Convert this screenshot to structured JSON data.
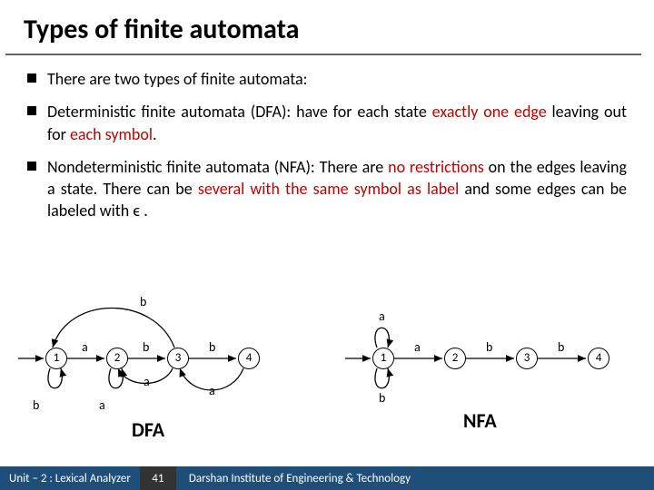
{
  "title": "Types of finite automata",
  "bullets": {
    "b1": "There are two types of finite automata:",
    "b2a": "Deterministic finite automata (DFA): ",
    "b2b": "have for each state ",
    "b2c": "exactly one edge",
    "b2d": " leaving out for ",
    "b2e": "each symbol",
    "b2f": ".",
    "b3a": "Nondeterministic finite automata (NFA): There are ",
    "b3b": "no restrictions",
    "b3c": " on the edges leaving a state. There can be ",
    "b3d": "several with the same symbol as label",
    "b3e": " and some edges can be labeled with ",
    "b3f": "ϵ",
    "b3g": " ."
  },
  "dfa": {
    "title": "DFA",
    "states": {
      "s1": "1",
      "s2": "2",
      "s3": "3",
      "s4": "4"
    },
    "labels": {
      "t12": "a",
      "t23": "b",
      "t34": "b",
      "loop1": "b",
      "loop2": "a",
      "t31top": "b",
      "t32bot": "a",
      "t43": "a"
    }
  },
  "nfa": {
    "title": "NFA",
    "states": {
      "s1": "1",
      "s2": "2",
      "s3": "3",
      "s4": "4"
    },
    "labels": {
      "t12": "a",
      "t23": "b",
      "t34": "b",
      "loop1top": "a",
      "loop1bot": "b"
    }
  },
  "footer": {
    "left": "Unit – 2  : Lexical Analyzer",
    "page": "41",
    "right": "Darshan Institute of Engineering & Technology"
  }
}
